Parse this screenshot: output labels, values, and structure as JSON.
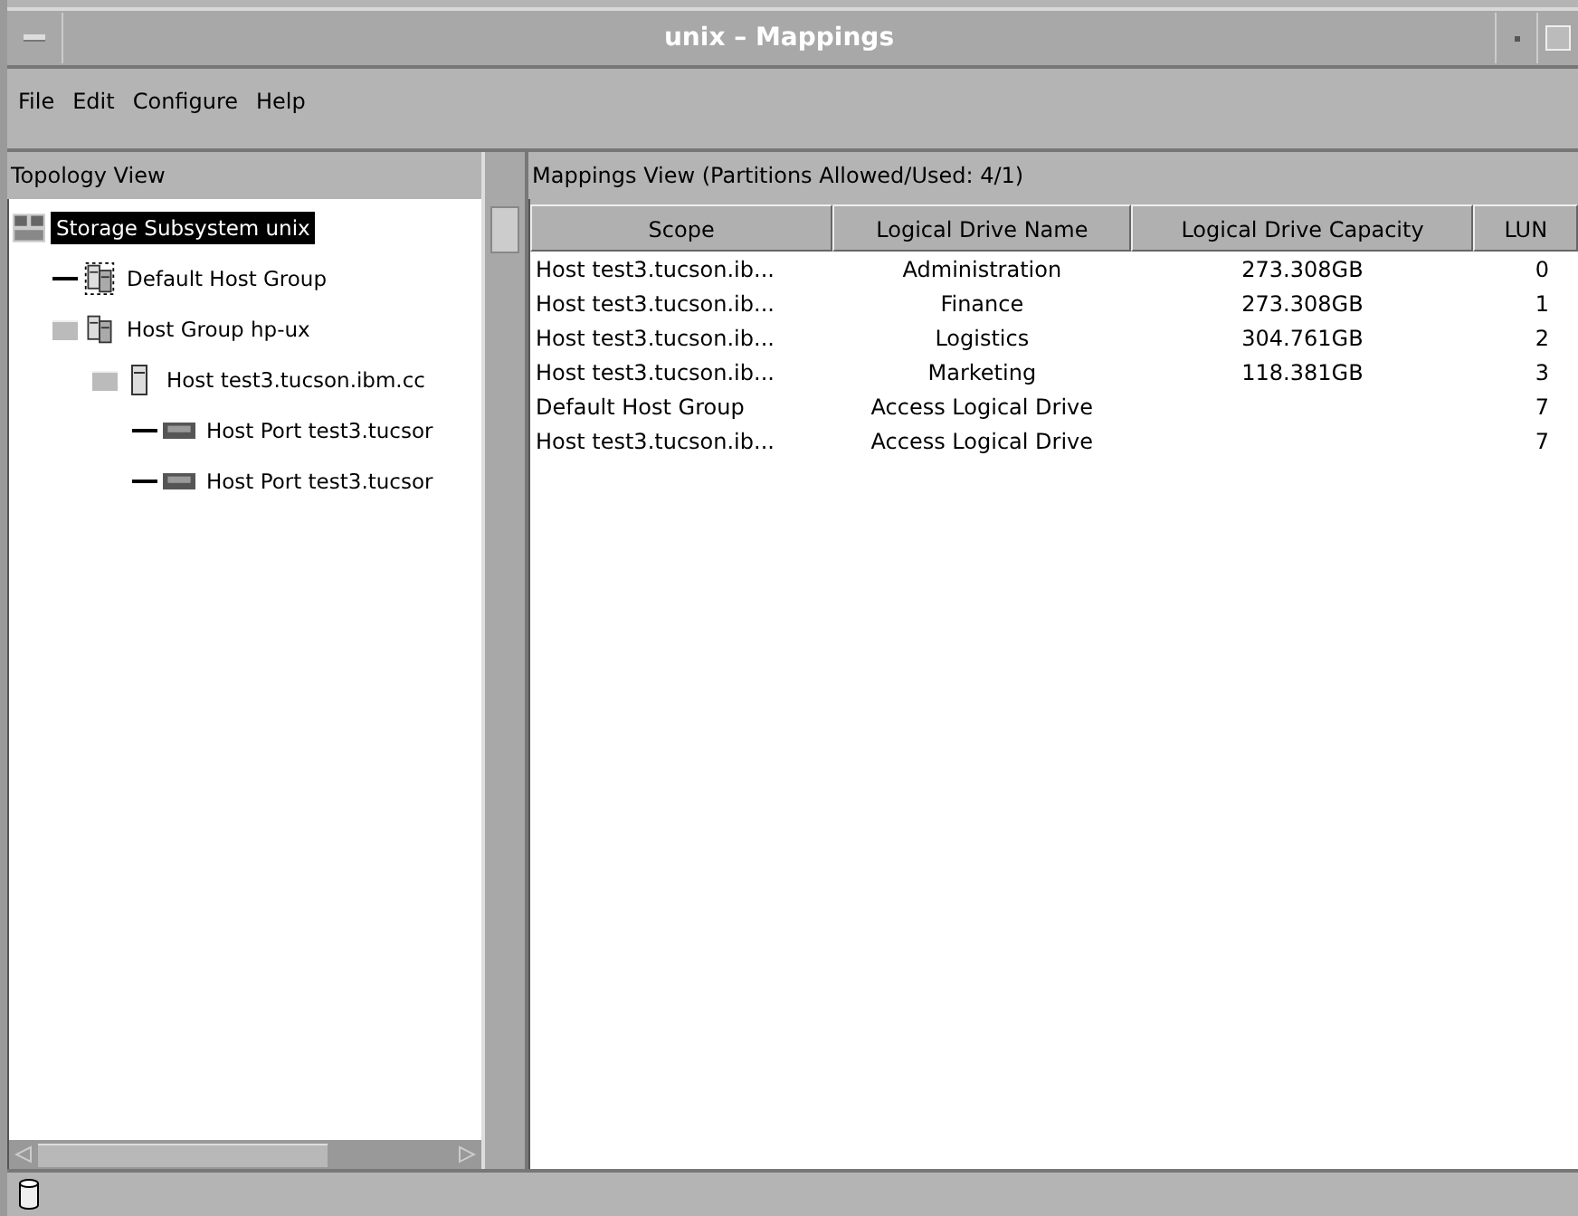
{
  "window": {
    "title": "unix – Mappings"
  },
  "menu": [
    {
      "label": "File"
    },
    {
      "label": "Edit"
    },
    {
      "label": "Configure"
    },
    {
      "label": "Help"
    }
  ],
  "topology": {
    "title": "Topology View",
    "tree": [
      {
        "label": "Storage Subsystem unix",
        "kind": "subsystem",
        "selected": true,
        "children": [
          {
            "label": "Default Host Group",
            "kind": "default-group",
            "selected": false
          },
          {
            "label": "Host Group hp-ux",
            "kind": "group",
            "selected": false,
            "children": [
              {
                "label": "Host test3.tucson.ibm.cc",
                "kind": "host",
                "selected": false,
                "children": [
                  {
                    "label": "Host Port test3.tucsor",
                    "kind": "port",
                    "selected": false
                  },
                  {
                    "label": "Host Port test3.tucsor",
                    "kind": "port",
                    "selected": false
                  }
                ]
              }
            ]
          }
        ]
      }
    ]
  },
  "mappings": {
    "title": "Mappings View (Partitions Allowed/Used: 4/1)",
    "columns": [
      "Scope",
      "Logical Drive Name",
      "Logical Drive Capacity",
      "LUN"
    ],
    "rows": [
      [
        "Host test3.tucson.ib...",
        "Administration",
        "273.308GB",
        "0"
      ],
      [
        "Host test3.tucson.ib...",
        "Finance",
        "273.308GB",
        "1"
      ],
      [
        "Host test3.tucson.ib...",
        "Logistics",
        "304.761GB",
        "2"
      ],
      [
        "Host test3.tucson.ib...",
        "Marketing",
        "118.381GB",
        "3"
      ],
      [
        "Default Host Group",
        "Access Logical Drive",
        "",
        "7"
      ],
      [
        "Host test3.tucson.ib...",
        "Access Logical Drive",
        "",
        "7"
      ]
    ]
  }
}
